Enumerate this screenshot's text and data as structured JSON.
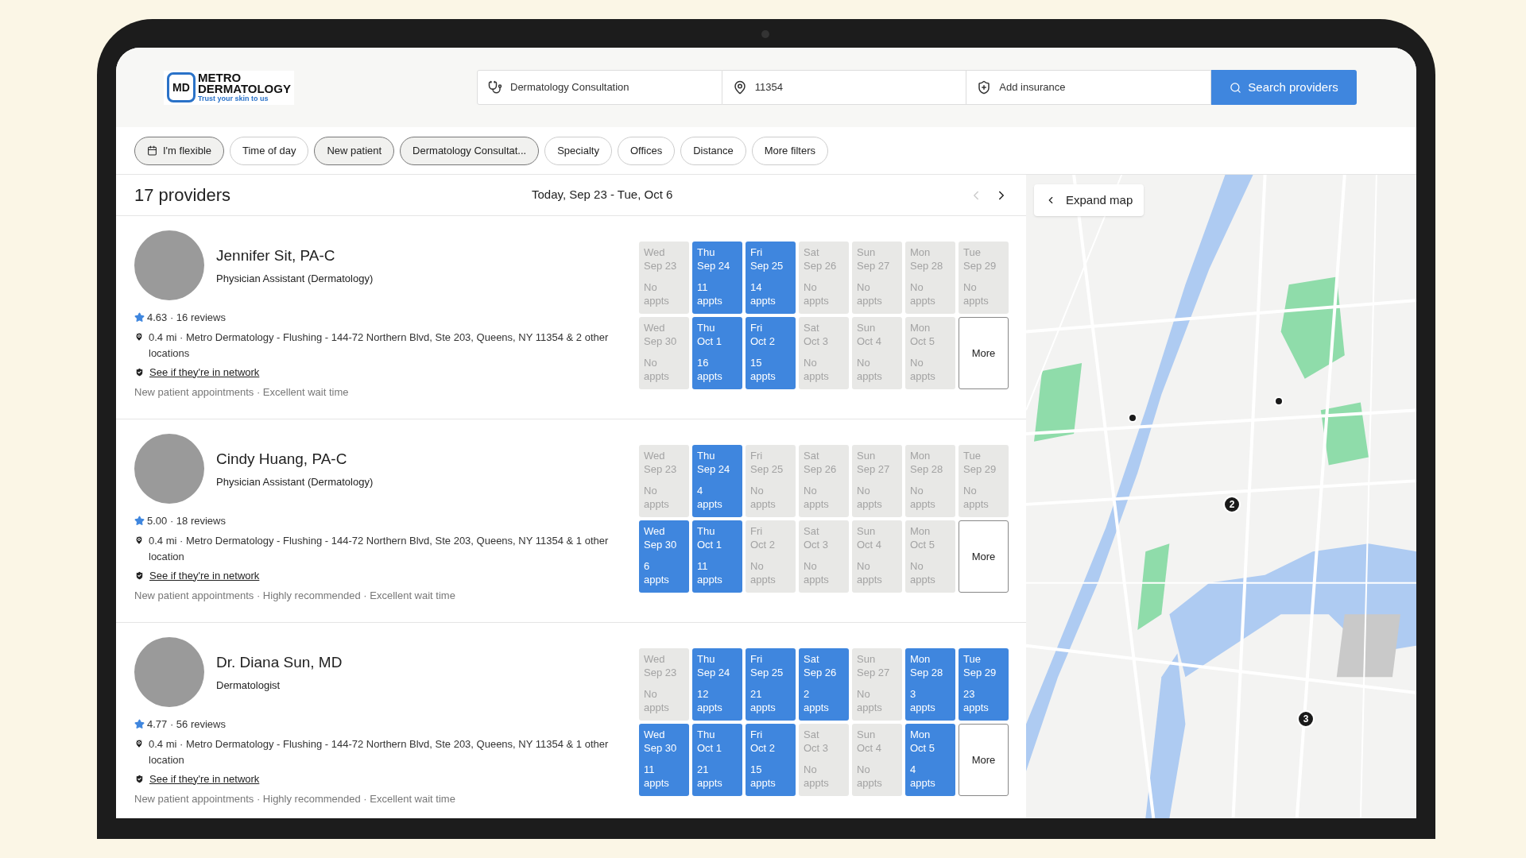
{
  "logo": {
    "badge": "MD",
    "line1": "METRO",
    "line2": "DERMATOLOGY",
    "tagline": "Trust your skin to us"
  },
  "search": {
    "reason": "Dermatology Consultation",
    "zip": "11354",
    "insurance_placeholder": "Add insurance",
    "button": "Search providers"
  },
  "filters": [
    {
      "label": "I'm flexible",
      "selected": true,
      "kind": "calendar"
    },
    {
      "label": "Time of day",
      "selected": false,
      "kind": "plain"
    },
    {
      "label": "New patient",
      "selected": true,
      "kind": "plain"
    },
    {
      "label": "Dermatology Consultat...",
      "selected": true,
      "kind": "plain"
    },
    {
      "label": "Specialty",
      "selected": false,
      "kind": "plain"
    },
    {
      "label": "Offices",
      "selected": false,
      "kind": "plain"
    },
    {
      "label": "Distance",
      "selected": false,
      "kind": "plain"
    },
    {
      "label": "More filters",
      "selected": false,
      "kind": "plain"
    }
  ],
  "results": {
    "count": "17 providers",
    "range": "Today, Sep 23 - Tue, Oct 6",
    "prev": {
      "disabled": true
    },
    "next": {
      "disabled": false
    }
  },
  "providers": [
    {
      "name": "Jennifer Sit, PA-C",
      "title": "Physician Assistant (Dermatology)",
      "rating": "4.63 · 16 reviews",
      "location": "0.4 mi · Metro Dermatology - Flushing - 144-72 Northern Blvd, Ste 203, Queens, NY 11354 & 2 other locations",
      "network": "See if they're in network",
      "tags": "New patient appointments · Excellent wait time",
      "more": "More",
      "slots": [
        {
          "day": "Wed",
          "date": "Sep 23",
          "count": "No",
          "unit": "appts",
          "available": false
        },
        {
          "day": "Thu",
          "date": "Sep 24",
          "count": "11",
          "unit": "appts",
          "available": true
        },
        {
          "day": "Fri",
          "date": "Sep 25",
          "count": "14",
          "unit": "appts",
          "available": true
        },
        {
          "day": "Sat",
          "date": "Sep 26",
          "count": "No",
          "unit": "appts",
          "available": false
        },
        {
          "day": "Sun",
          "date": "Sep 27",
          "count": "No",
          "unit": "appts",
          "available": false
        },
        {
          "day": "Mon",
          "date": "Sep 28",
          "count": "No",
          "unit": "appts",
          "available": false
        },
        {
          "day": "Tue",
          "date": "Sep 29",
          "count": "No",
          "unit": "appts",
          "available": false
        },
        {
          "day": "Wed",
          "date": "Sep 30",
          "count": "No",
          "unit": "appts",
          "available": false
        },
        {
          "day": "Thu",
          "date": "Oct 1",
          "count": "16",
          "unit": "appts",
          "available": true
        },
        {
          "day": "Fri",
          "date": "Oct 2",
          "count": "15",
          "unit": "appts",
          "available": true
        },
        {
          "day": "Sat",
          "date": "Oct 3",
          "count": "No",
          "unit": "appts",
          "available": false
        },
        {
          "day": "Sun",
          "date": "Oct 4",
          "count": "No",
          "unit": "appts",
          "available": false
        },
        {
          "day": "Mon",
          "date": "Oct 5",
          "count": "No",
          "unit": "appts",
          "available": false
        }
      ]
    },
    {
      "name": "Cindy Huang, PA-C",
      "title": "Physician Assistant (Dermatology)",
      "rating": "5.00 · 18 reviews",
      "location": "0.4 mi · Metro Dermatology - Flushing - 144-72 Northern Blvd, Ste 203, Queens, NY 11354 & 1 other location",
      "network": "See if they're in network",
      "tags": "New patient appointments · Highly recommended · Excellent wait time",
      "more": "More",
      "slots": [
        {
          "day": "Wed",
          "date": "Sep 23",
          "count": "No",
          "unit": "appts",
          "available": false
        },
        {
          "day": "Thu",
          "date": "Sep 24",
          "count": "4",
          "unit": "appts",
          "available": true
        },
        {
          "day": "Fri",
          "date": "Sep 25",
          "count": "No",
          "unit": "appts",
          "available": false
        },
        {
          "day": "Sat",
          "date": "Sep 26",
          "count": "No",
          "unit": "appts",
          "available": false
        },
        {
          "day": "Sun",
          "date": "Sep 27",
          "count": "No",
          "unit": "appts",
          "available": false
        },
        {
          "day": "Mon",
          "date": "Sep 28",
          "count": "No",
          "unit": "appts",
          "available": false
        },
        {
          "day": "Tue",
          "date": "Sep 29",
          "count": "No",
          "unit": "appts",
          "available": false
        },
        {
          "day": "Wed",
          "date": "Sep 30",
          "count": "6",
          "unit": "appts",
          "available": true
        },
        {
          "day": "Thu",
          "date": "Oct 1",
          "count": "11",
          "unit": "appts",
          "available": true
        },
        {
          "day": "Fri",
          "date": "Oct 2",
          "count": "No",
          "unit": "appts",
          "available": false
        },
        {
          "day": "Sat",
          "date": "Oct 3",
          "count": "No",
          "unit": "appts",
          "available": false
        },
        {
          "day": "Sun",
          "date": "Oct 4",
          "count": "No",
          "unit": "appts",
          "available": false
        },
        {
          "day": "Mon",
          "date": "Oct 5",
          "count": "No",
          "unit": "appts",
          "available": false
        }
      ]
    },
    {
      "name": "Dr. Diana Sun, MD",
      "title": "Dermatologist",
      "rating": "4.77 · 56 reviews",
      "location": "0.4 mi · Metro Dermatology - Flushing - 144-72 Northern Blvd, Ste 203, Queens, NY 11354 & 1 other location",
      "network": "See if they're in network",
      "tags": "New patient appointments · Highly recommended · Excellent wait time",
      "more": "More",
      "slots": [
        {
          "day": "Wed",
          "date": "Sep 23",
          "count": "No",
          "unit": "appts",
          "available": false
        },
        {
          "day": "Thu",
          "date": "Sep 24",
          "count": "12",
          "unit": "appts",
          "available": true
        },
        {
          "day": "Fri",
          "date": "Sep 25",
          "count": "21",
          "unit": "appts",
          "available": true
        },
        {
          "day": "Sat",
          "date": "Sep 26",
          "count": "2",
          "unit": "appts",
          "available": true
        },
        {
          "day": "Sun",
          "date": "Sep 27",
          "count": "No",
          "unit": "appts",
          "available": false
        },
        {
          "day": "Mon",
          "date": "Sep 28",
          "count": "3",
          "unit": "appts",
          "available": true
        },
        {
          "day": "Tue",
          "date": "Sep 29",
          "count": "23",
          "unit": "appts",
          "available": true
        },
        {
          "day": "Wed",
          "date": "Sep 30",
          "count": "11",
          "unit": "appts",
          "available": true
        },
        {
          "day": "Thu",
          "date": "Oct 1",
          "count": "21",
          "unit": "appts",
          "available": true
        },
        {
          "day": "Fri",
          "date": "Oct 2",
          "count": "15",
          "unit": "appts",
          "available": true
        },
        {
          "day": "Sat",
          "date": "Oct 3",
          "count": "No",
          "unit": "appts",
          "available": false
        },
        {
          "day": "Sun",
          "date": "Oct 4",
          "count": "No",
          "unit": "appts",
          "available": false
        },
        {
          "day": "Mon",
          "date": "Oct 5",
          "count": "4",
          "unit": "appts",
          "available": true
        }
      ]
    }
  ],
  "map": {
    "expand": "Expand map",
    "pins": [
      {
        "kind": "dot"
      },
      {
        "kind": "dot"
      },
      {
        "kind": "cluster",
        "label": "2"
      },
      {
        "kind": "cluster",
        "label": "3"
      }
    ]
  }
}
